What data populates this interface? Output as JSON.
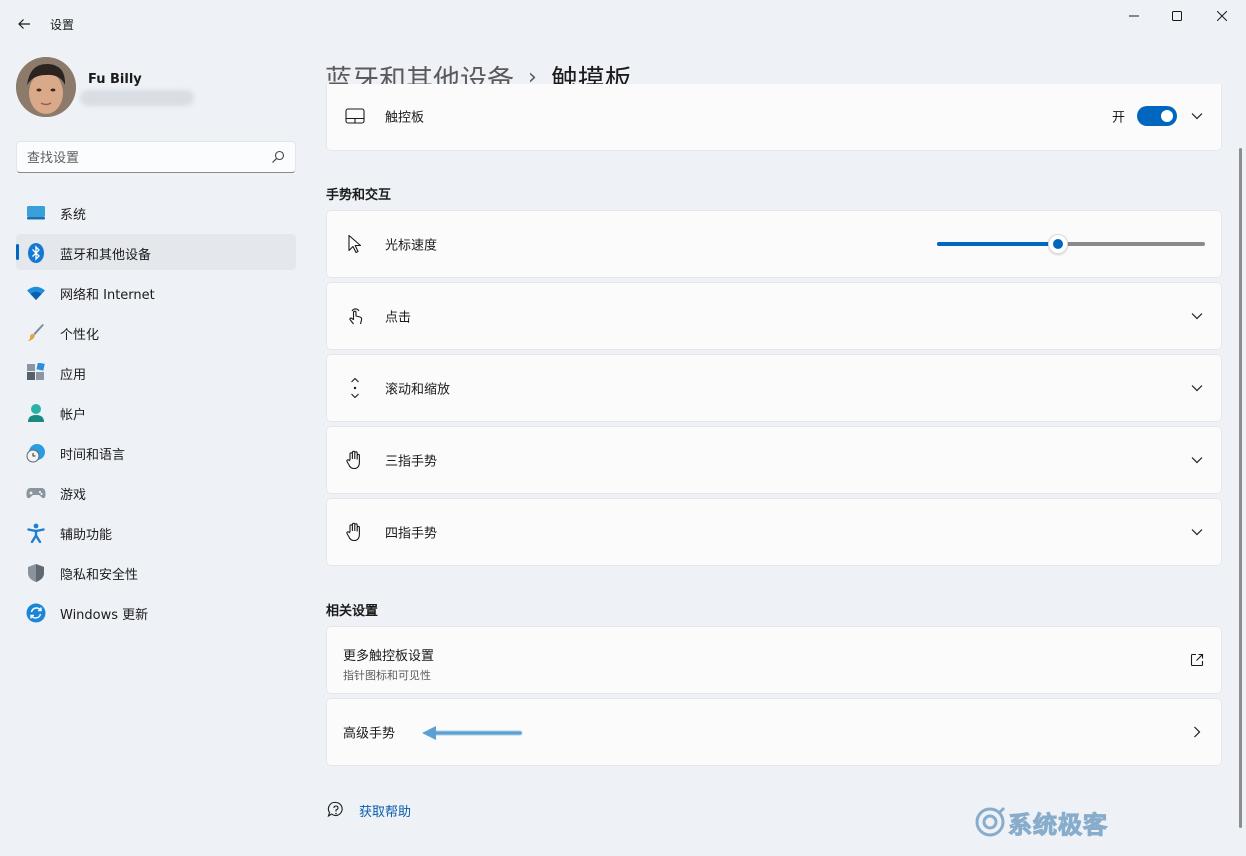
{
  "window": {
    "title": "设置"
  },
  "user": {
    "name": "Fu Billy"
  },
  "search": {
    "placeholder": "查找设置"
  },
  "sidebar": {
    "items": [
      {
        "label": "系统",
        "icon": "system-icon",
        "active": false
      },
      {
        "label": "蓝牙和其他设备",
        "icon": "bluetooth-icon",
        "active": true
      },
      {
        "label": "网络和 Internet",
        "icon": "wifi-icon",
        "active": false
      },
      {
        "label": "个性化",
        "icon": "brush-icon",
        "active": false
      },
      {
        "label": "应用",
        "icon": "apps-icon",
        "active": false
      },
      {
        "label": "帐户",
        "icon": "account-icon",
        "active": false
      },
      {
        "label": "时间和语言",
        "icon": "globe-clock-icon",
        "active": false
      },
      {
        "label": "游戏",
        "icon": "gamepad-icon",
        "active": false
      },
      {
        "label": "辅助功能",
        "icon": "accessibility-icon",
        "active": false
      },
      {
        "label": "隐私和安全性",
        "icon": "shield-icon",
        "active": false
      },
      {
        "label": "Windows 更新",
        "icon": "update-icon",
        "active": false
      }
    ]
  },
  "breadcrumb": {
    "parent": "蓝牙和其他设备",
    "separator": "›",
    "current": "触摸板"
  },
  "touchpad": {
    "label": "触控板",
    "toggle_text": "开",
    "toggle_on": true
  },
  "gestures_section": {
    "title": "手势和交互",
    "cursor_speed": {
      "label": "光标速度",
      "value_fraction": 0.45
    },
    "items": [
      {
        "label": "点击",
        "icon": "tap-icon"
      },
      {
        "label": "滚动和缩放",
        "icon": "scroll-icon"
      },
      {
        "label": "三指手势",
        "icon": "hand-icon"
      },
      {
        "label": "四指手势",
        "icon": "hand-icon"
      }
    ]
  },
  "related_section": {
    "title": "相关设置",
    "more_touchpad": {
      "label": "更多触控板设置",
      "sub": "指针图标和可见性"
    },
    "advanced_gestures": {
      "label": "高级手势"
    }
  },
  "help": {
    "label": "获取帮助"
  },
  "watermark": {
    "text": "系统极客"
  },
  "colors": {
    "accent": "#0067c0",
    "background": "#eef2f7",
    "card": "#fbfbfc",
    "link": "#0b5cad",
    "annotation_arrow": "#5aa0d2"
  }
}
